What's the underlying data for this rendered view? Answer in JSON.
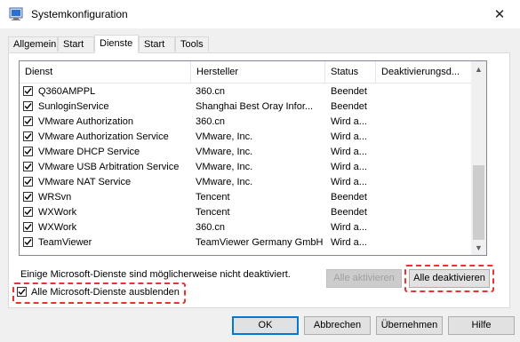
{
  "window": {
    "title": "Systemkonfiguration",
    "close_glyph": "✕"
  },
  "tabs": [
    "Allgemein",
    "Start",
    "Dienste",
    "Start",
    "Tools"
  ],
  "active_tab": "Dienste",
  "columns": {
    "service": "Dienst",
    "manufacturer": "Hersteller",
    "status": "Status",
    "disabled_date": "Deaktivierungsd..."
  },
  "services": [
    {
      "name": "Q360AMPPL",
      "manufacturer": "360.cn",
      "status": "Beendet",
      "checked": true
    },
    {
      "name": "SunloginService",
      "manufacturer": "Shanghai Best Oray Infor...",
      "status": "Beendet",
      "checked": true
    },
    {
      "name": "VMware Authorization",
      "manufacturer": "360.cn",
      "status": "Wird a...",
      "checked": true
    },
    {
      "name": "VMware Authorization Service",
      "manufacturer": "VMware, Inc.",
      "status": "Wird a...",
      "checked": true
    },
    {
      "name": "VMware DHCP Service",
      "manufacturer": "VMware, Inc.",
      "status": "Wird a...",
      "checked": true
    },
    {
      "name": "VMware USB Arbitration Service",
      "manufacturer": "VMware, Inc.",
      "status": "Wird a...",
      "checked": true
    },
    {
      "name": "VMware NAT Service",
      "manufacturer": "VMware, Inc.",
      "status": "Wird a...",
      "checked": true
    },
    {
      "name": "WRSvn",
      "manufacturer": "Tencent",
      "status": "Beendet",
      "checked": true
    },
    {
      "name": "WXWork",
      "manufacturer": "Tencent",
      "status": "Beendet",
      "checked": true
    },
    {
      "name": "WXWork",
      "manufacturer": "360.cn",
      "status": "Wird a...",
      "checked": true
    },
    {
      "name": "TeamViewer",
      "manufacturer": "TeamViewer Germany GmbH",
      "status": "Wird a...",
      "checked": true
    }
  ],
  "note": "Einige Microsoft-Dienste sind möglicherweise nicht deaktiviert.",
  "buttons": {
    "enable_all": "Alle aktivieren",
    "disable_all": "Alle deaktivieren",
    "ok": "OK",
    "cancel": "Abbrechen",
    "apply": "Übernehmen",
    "help": "Hilfe"
  },
  "hide_ms": {
    "label": "Alle Microsoft-Dienste ausblenden",
    "checked": true
  },
  "colors": {
    "highlight": "#e8342f",
    "accent": "#0078d7"
  }
}
